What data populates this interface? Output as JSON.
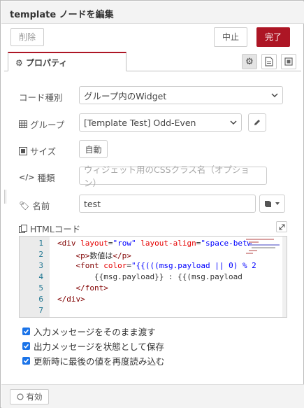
{
  "dialog": {
    "title": "template ノードを編集"
  },
  "toolbar": {
    "delete_label": "削除",
    "cancel_label": "中止",
    "done_label": "完了"
  },
  "tabs": {
    "properties_label": "プロパティ"
  },
  "form": {
    "code_type": {
      "label": "コード種別",
      "value": "グループ内のWidget"
    },
    "group": {
      "label": "グループ",
      "value": "[Template Test] Odd-Even"
    },
    "size": {
      "label": "サイズ",
      "button_label": "自動"
    },
    "class": {
      "label": "種類",
      "placeholder": "ウィジェット用のCSSクラス名（オプション）"
    },
    "name": {
      "label": "名前",
      "value": "test"
    },
    "html": {
      "label": "HTMLコード"
    }
  },
  "editor": {
    "line_numbers": [
      "1",
      "2",
      "3",
      "4",
      "5",
      "6",
      "7"
    ]
  },
  "options": {
    "pass_through": "入力メッセージをそのまま渡す",
    "store_state": "出力メッセージを状態として保存",
    "reload_last": "更新時に最後の値を再度読み込む"
  },
  "footer": {
    "enabled_label": "有効"
  },
  "colors": {
    "accent": "#ad1625",
    "checkbox": "#1a73e8"
  }
}
